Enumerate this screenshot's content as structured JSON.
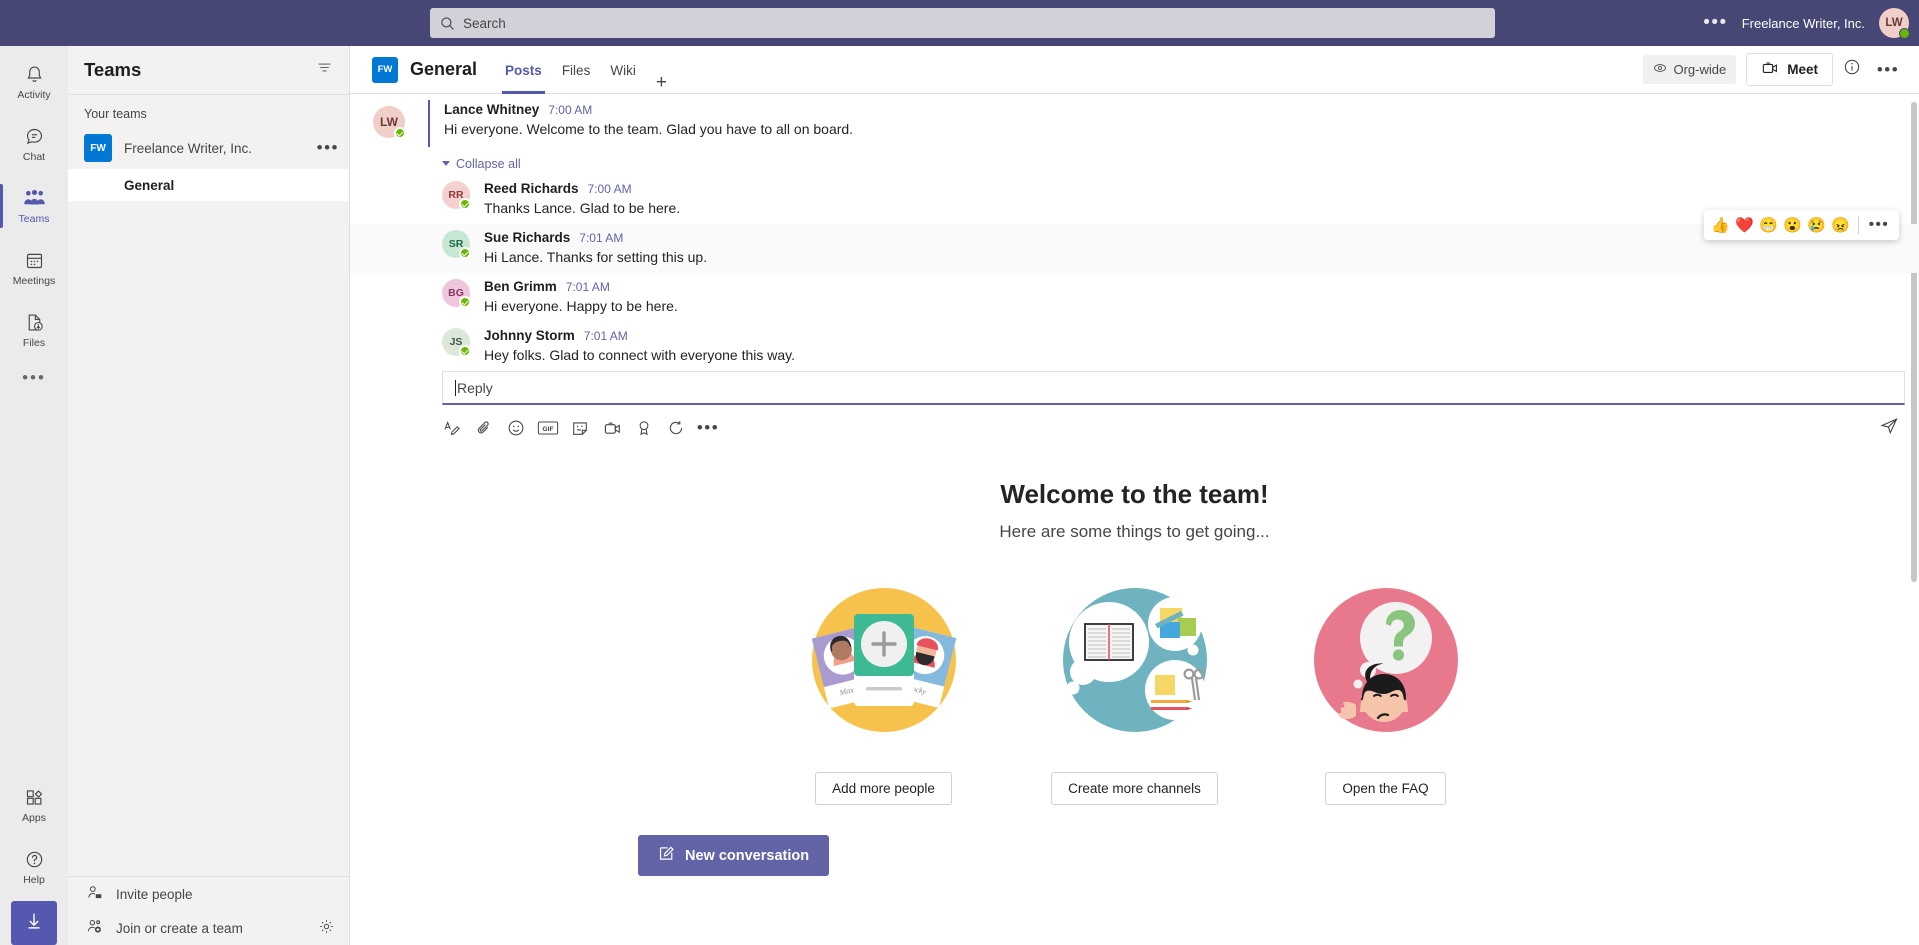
{
  "topbar": {
    "search_placeholder": "Search",
    "org_label": "Freelance Writer, Inc.",
    "user_initials": "LW",
    "more_label": "•••"
  },
  "rail": {
    "items": [
      {
        "label": "Activity",
        "icon": "bell-icon",
        "active": false
      },
      {
        "label": "Chat",
        "icon": "chat-icon",
        "active": false
      },
      {
        "label": "Teams",
        "icon": "teams-icon",
        "active": true
      },
      {
        "label": "Meetings",
        "icon": "calendar-icon",
        "active": false
      },
      {
        "label": "Files",
        "icon": "files-icon",
        "active": false
      }
    ],
    "more_label": "•••",
    "bottom": [
      {
        "label": "Apps",
        "icon": "apps-icon"
      },
      {
        "label": "Help",
        "icon": "help-icon"
      }
    ],
    "download_icon": "download-icon"
  },
  "sidebar": {
    "title": "Teams",
    "filter_icon": "filter-icon",
    "section_label": "Your teams",
    "team": {
      "initials": "FW",
      "name": "Freelance Writer, Inc.",
      "more_label": "•••"
    },
    "channel": "General",
    "footer": [
      {
        "label": "Invite people",
        "icon": "invite-person-icon"
      },
      {
        "label": "Join or create a team",
        "icon": "add-person-icon"
      }
    ],
    "settings_icon": "gear-icon"
  },
  "channel_header": {
    "avatar_initials": "FW",
    "title": "General",
    "tabs": [
      {
        "label": "Posts",
        "active": true
      },
      {
        "label": "Files",
        "active": false
      },
      {
        "label": "Wiki",
        "active": false
      }
    ],
    "add_tab_label": "+",
    "org_wide_label": "Org-wide",
    "meet_label": "Meet",
    "info_icon": "info-icon",
    "more_label": "•••"
  },
  "thread": {
    "root": {
      "initials": "LW",
      "avatar_bg": "#f0cfc9",
      "avatar_fg": "#6b3a34",
      "author": "Lance Whitney",
      "time": "7:00 AM",
      "text": "Hi everyone. Welcome to the team. Glad you have to all on board."
    },
    "collapse_label": "Collapse all",
    "replies": [
      {
        "initials": "RR",
        "avatar_bg": "#f5d0d0",
        "avatar_fg": "#8b3a3a",
        "author": "Reed Richards",
        "time": "7:00 AM",
        "text": "Thanks Lance. Glad to be here."
      },
      {
        "initials": "SR",
        "avatar_bg": "#c6e7d4",
        "avatar_fg": "#1c6b43",
        "author": "Sue Richards",
        "time": "7:01 AM",
        "text": "Hi Lance. Thanks for setting this up."
      },
      {
        "initials": "BG",
        "avatar_bg": "#efc7dd",
        "avatar_fg": "#8a3566",
        "author": "Ben Grimm",
        "time": "7:01 AM",
        "text": "Hi everyone. Happy to be here."
      },
      {
        "initials": "JS",
        "avatar_bg": "#dde6da",
        "avatar_fg": "#3e5c3e",
        "author": "Johnny Storm",
        "time": "7:01 AM",
        "text": "Hey folks. Glad to connect with everyone this way."
      }
    ],
    "reactions": [
      {
        "name": "thumbs-up-reaction",
        "glyph": "👍"
      },
      {
        "name": "heart-reaction",
        "glyph": "❤️"
      },
      {
        "name": "laugh-reaction",
        "glyph": "😁"
      },
      {
        "name": "surprised-reaction",
        "glyph": "😮"
      },
      {
        "name": "sad-reaction",
        "glyph": "😢"
      },
      {
        "name": "angry-reaction",
        "glyph": "😠"
      }
    ],
    "reaction_more_label": "•••"
  },
  "composer": {
    "placeholder": "Reply",
    "tools": [
      {
        "name": "format-icon",
        "title": "Format"
      },
      {
        "name": "attach-icon",
        "title": "Attach"
      },
      {
        "name": "emoji-icon",
        "title": "Emoji"
      },
      {
        "name": "giphy-icon",
        "title": "GIF"
      },
      {
        "name": "sticker-icon",
        "title": "Sticker"
      },
      {
        "name": "meet-now-icon",
        "title": "Meet now"
      },
      {
        "name": "praise-icon",
        "title": "Praise"
      },
      {
        "name": "loop-icon",
        "title": "Loop components"
      }
    ],
    "more_label": "•••",
    "send_icon": "send-icon"
  },
  "welcome": {
    "title": "Welcome to the team!",
    "subtitle": "Here are some things to get going...",
    "cards": [
      {
        "art": "people-cards-illustration",
        "button": "Add more people",
        "bg": "#f7c24b"
      },
      {
        "art": "notebook-thought-illustration",
        "button": "Create more channels",
        "bg": "#6eb3bf"
      },
      {
        "art": "question-person-illustration",
        "button": "Open the FAQ",
        "bg": "#e8798c"
      }
    ]
  },
  "new_conversation": {
    "label": "New conversation",
    "icon": "compose-icon"
  },
  "colors": {
    "brand_purple": "#6264a7",
    "topbar_purple": "#464775",
    "accent_blue": "#0078d4",
    "presence_green": "#6bb700"
  }
}
